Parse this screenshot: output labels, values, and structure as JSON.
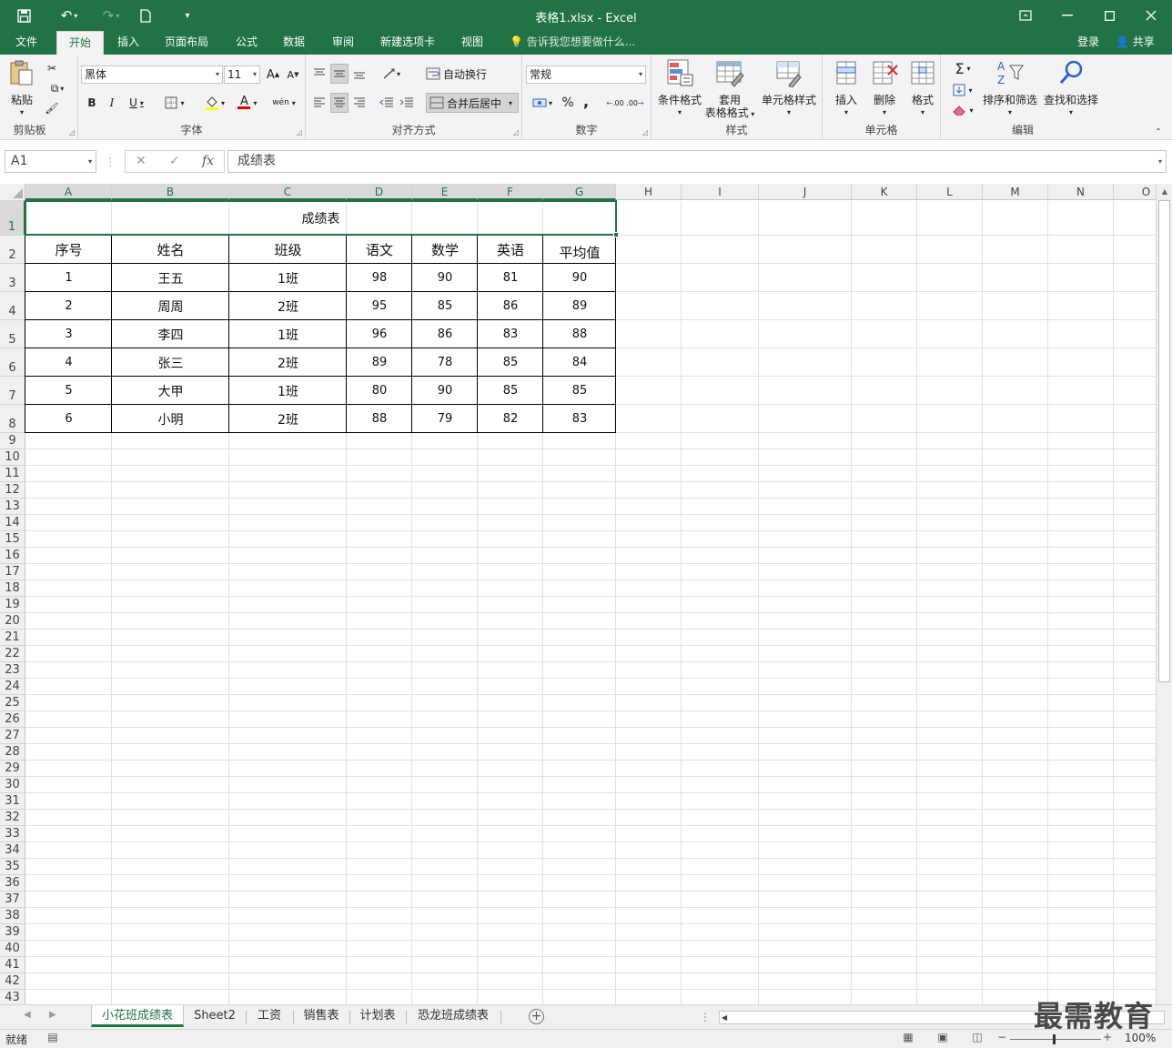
{
  "window": {
    "title": "表格1.xlsx - Excel",
    "accent": "#217346"
  },
  "menu": {
    "tabs": [
      "文件",
      "开始",
      "插入",
      "页面布局",
      "公式",
      "数据",
      "审阅",
      "新建选项卡",
      "视图"
    ],
    "active_tab": "开始",
    "tell_me": "告诉我您想要做什么...",
    "login": "登录",
    "share": "共享"
  },
  "ribbon": {
    "clipboard": {
      "label": "剪贴板",
      "paste": "粘贴"
    },
    "font": {
      "label": "字体",
      "font_name": "黑体",
      "font_size": "11",
      "bold": "B",
      "italic": "I",
      "underline": "U",
      "grow": "A",
      "shrink": "A",
      "font_color": "A",
      "phonetic": "wén"
    },
    "alignment": {
      "label": "对齐方式",
      "wrap_text": "自动换行",
      "merge_center": "合并后居中"
    },
    "number": {
      "label": "数字",
      "format": "常规",
      "percent": "%",
      "comma": ",",
      "inc_decimal": ".00",
      "dec_decimal": ".00"
    },
    "styles": {
      "label": "样式",
      "conditional": "条件格式",
      "table_format_1": "套用",
      "table_format_2": "表格格式",
      "cell_styles": "单元格样式"
    },
    "cells": {
      "label": "单元格",
      "insert": "插入",
      "delete": "删除",
      "format": "格式"
    },
    "editing": {
      "label": "编辑",
      "sort_filter": "排序和筛选",
      "find_select": "查找和选择"
    }
  },
  "formula_bar": {
    "name_box": "A1",
    "cancel": "✕",
    "enter": "✓",
    "fx": "fx",
    "content": "成绩表"
  },
  "grid": {
    "columns": [
      "A",
      "B",
      "C",
      "D",
      "E",
      "F",
      "G",
      "H",
      "I",
      "J",
      "K",
      "L",
      "M",
      "N",
      "O"
    ],
    "rows": [
      "1",
      "2",
      "3",
      "4",
      "5",
      "6",
      "7",
      "8",
      "9",
      "10",
      "11",
      "12",
      "13",
      "14",
      "15",
      "16",
      "17",
      "18",
      "19",
      "20",
      "21",
      "22",
      "23",
      "24",
      "25",
      "26",
      "27",
      "28",
      "29",
      "30",
      "31",
      "32",
      "33",
      "34",
      "35",
      "36",
      "37",
      "38",
      "39",
      "40",
      "41",
      "42",
      "43"
    ],
    "selected_cell": "A1"
  },
  "table": {
    "title": "成绩表",
    "headers": [
      "序号",
      "姓名",
      "班级",
      "语文",
      "数学",
      "英语",
      "平均值"
    ],
    "rows": [
      [
        "1",
        "王五",
        "1班",
        "98",
        "90",
        "81",
        "90"
      ],
      [
        "2",
        "周周",
        "2班",
        "95",
        "85",
        "86",
        "89"
      ],
      [
        "3",
        "李四",
        "1班",
        "96",
        "86",
        "83",
        "88"
      ],
      [
        "4",
        "张三",
        "2班",
        "89",
        "78",
        "85",
        "84"
      ],
      [
        "5",
        "大甲",
        "1班",
        "80",
        "90",
        "85",
        "85"
      ],
      [
        "6",
        "小明",
        "2班",
        "88",
        "79",
        "82",
        "83"
      ]
    ]
  },
  "sheets": {
    "tabs": [
      "小花班成绩表",
      "Sheet2",
      "工资",
      "销售表",
      "计划表",
      "恐龙班成绩表"
    ],
    "active": "小花班成绩表"
  },
  "status": {
    "ready": "就绪",
    "zoom": "100%",
    "zoom_minus": "−",
    "zoom_plus": "+"
  },
  "watermark": "最需教育"
}
